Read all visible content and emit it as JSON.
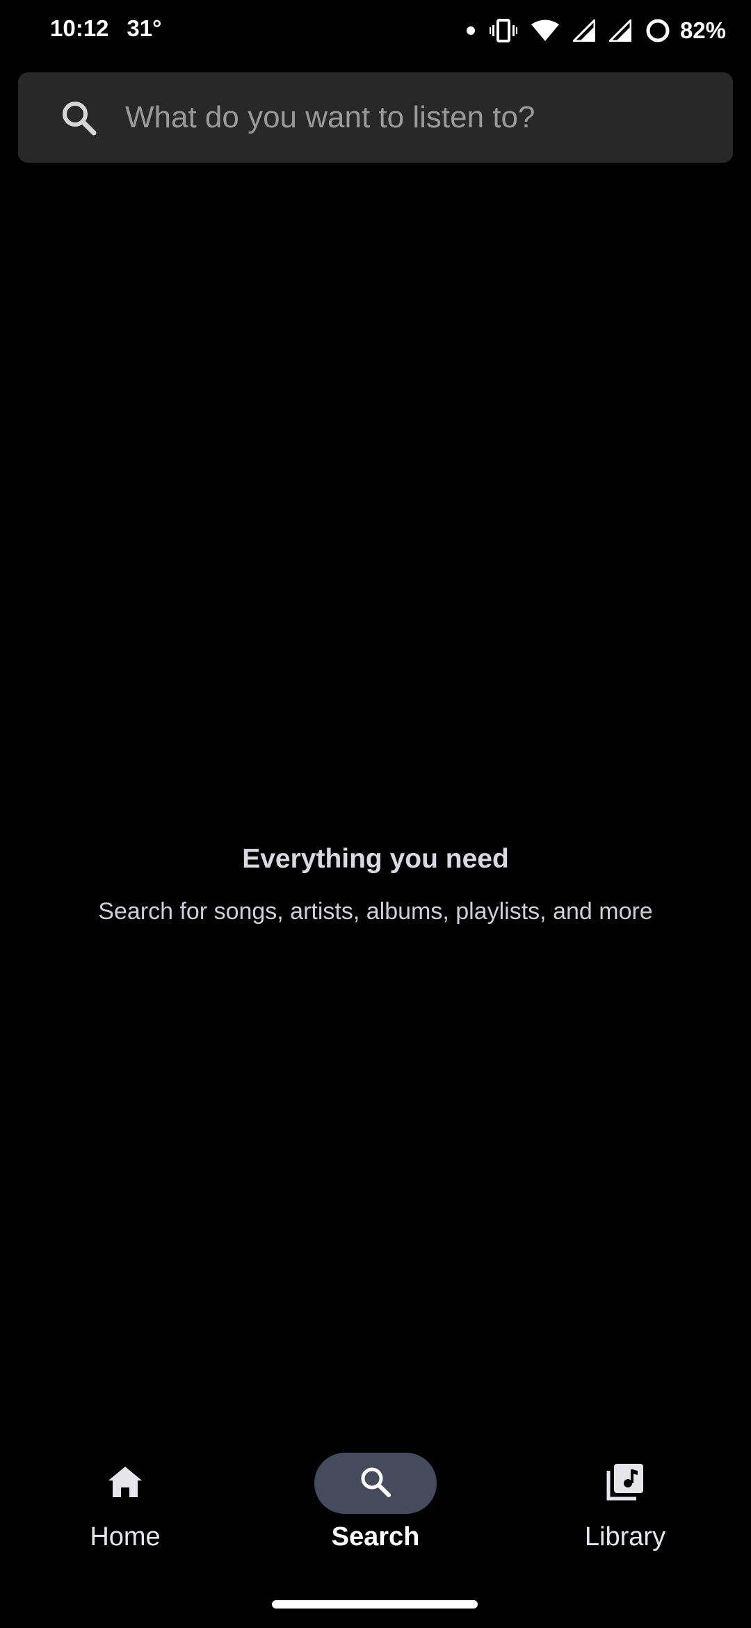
{
  "status_bar": {
    "time": "10:12",
    "temperature": "31°",
    "battery_percent": "82%",
    "icons": [
      "notification-dot-icon",
      "vibrate-icon",
      "wifi-icon",
      "cell-signal-icon",
      "cell-signal-icon",
      "battery-saver-icon"
    ]
  },
  "search": {
    "placeholder": "What do you want to listen to?",
    "value": "",
    "icon": "search-icon"
  },
  "empty_state": {
    "title": "Everything you need",
    "subtitle": "Search for songs, artists, albums, playlists, and more"
  },
  "bottom_nav": {
    "items": [
      {
        "label": "Home",
        "icon": "home-icon",
        "active": false
      },
      {
        "label": "Search",
        "icon": "search-icon",
        "active": true
      },
      {
        "label": "Library",
        "icon": "library-icon",
        "active": false
      }
    ]
  },
  "colors": {
    "background": "#000000",
    "search_bar_bg": "#282828",
    "active_nav_pill": "#464b5c",
    "text_primary": "#ffffff",
    "text_secondary": "#cfcfd4",
    "placeholder": "#9a9a9a"
  }
}
